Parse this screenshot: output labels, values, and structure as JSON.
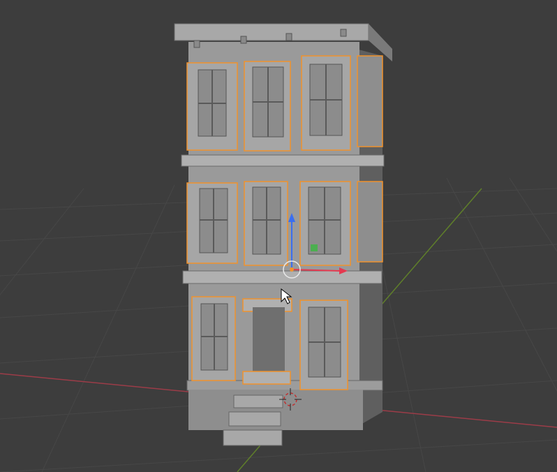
{
  "viewport": {
    "mode": "3d-viewport",
    "background": "#3d3d3d",
    "grid_color": "#4a4a4a",
    "x_axis_color": "#a0404a",
    "y_axis_color": "#6a8a2a"
  },
  "scene": {
    "object": "three-story-townhouse",
    "selection_outline_color": "#f0922c",
    "body_color": "#9a9a9a",
    "side_color": "#6e6e6e",
    "floors": 3,
    "windows_per_floor_front": [
      3,
      3,
      2
    ],
    "has_front_door": true,
    "entry_steps": 3
  },
  "gizmo": {
    "z_axis_color": "#3a6ef0",
    "y_axis_color": "#4caf50",
    "x_axis_color": "#e53950",
    "origin_color": "#f0922c"
  },
  "cursor": {
    "shape": "arrow-cursor"
  }
}
